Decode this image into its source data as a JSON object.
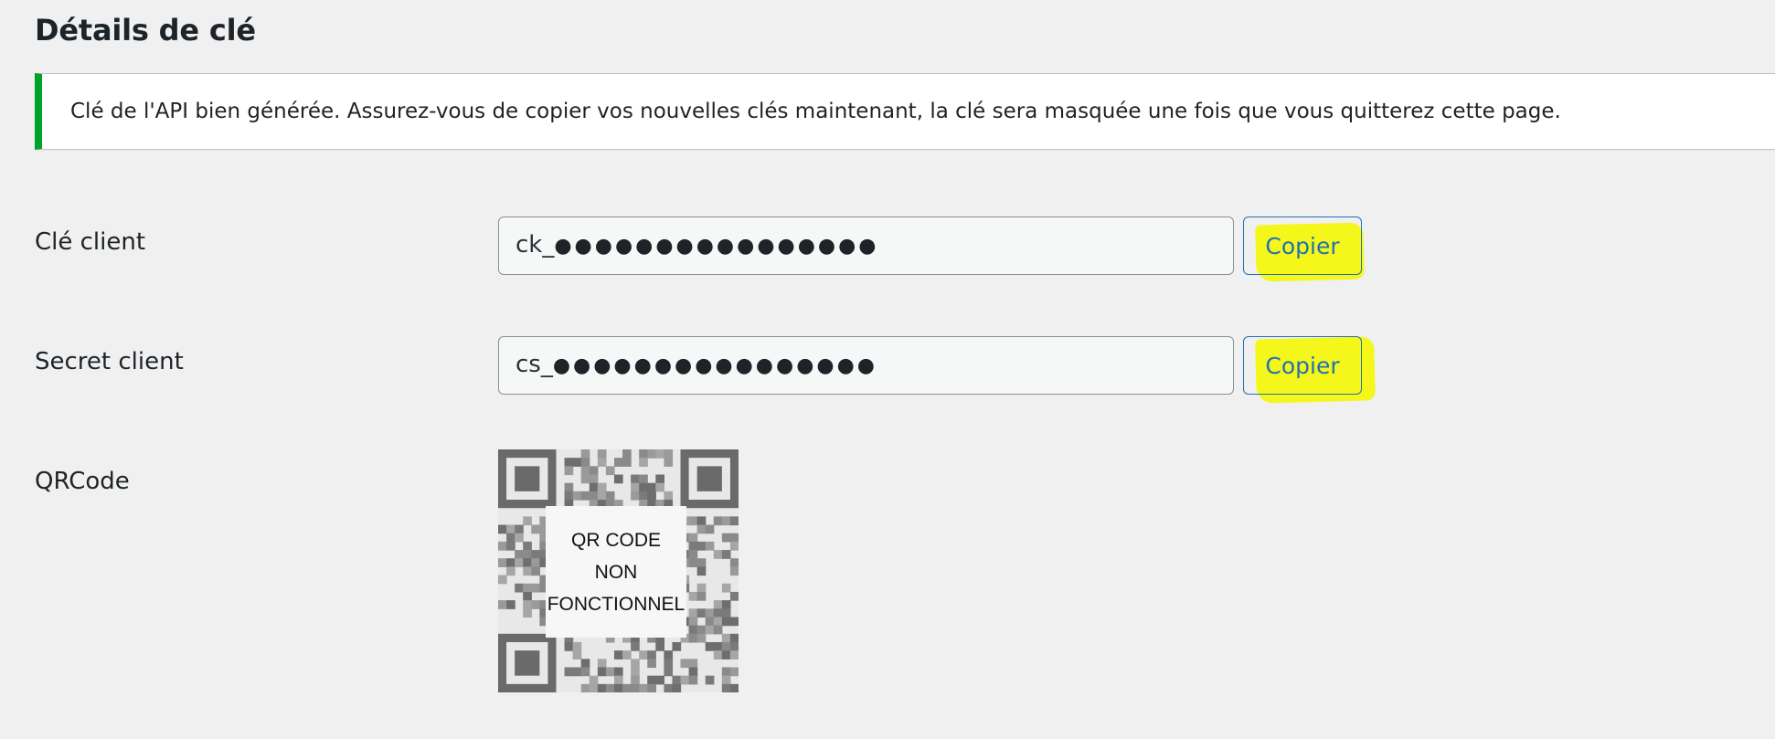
{
  "page": {
    "title": "Détails de clé"
  },
  "notice": {
    "message": "Clé de l'API bien générée. Assurez-vous de copier vos nouvelles clés maintenant, la clé sera masquée une fois que vous quitterez cette page.",
    "accent_color": "#00a32a"
  },
  "consumer_key": {
    "label": "Clé client",
    "prefix": "ck_",
    "masked": "●●●●●●●●●●●●●●●●",
    "copy_label": "Copier"
  },
  "consumer_secret": {
    "label": "Secret client",
    "prefix": "cs_",
    "masked": "●●●●●●●●●●●●●●●●",
    "copy_label": "Copier"
  },
  "qrcode": {
    "label": "QRCode",
    "overlay_lines": [
      "QR CODE",
      "NON",
      "FONCTIONNEL"
    ]
  },
  "colors": {
    "background": "#f0f0f1",
    "link_blue": "#2271b1",
    "highlight_yellow": "#f4f70e"
  }
}
